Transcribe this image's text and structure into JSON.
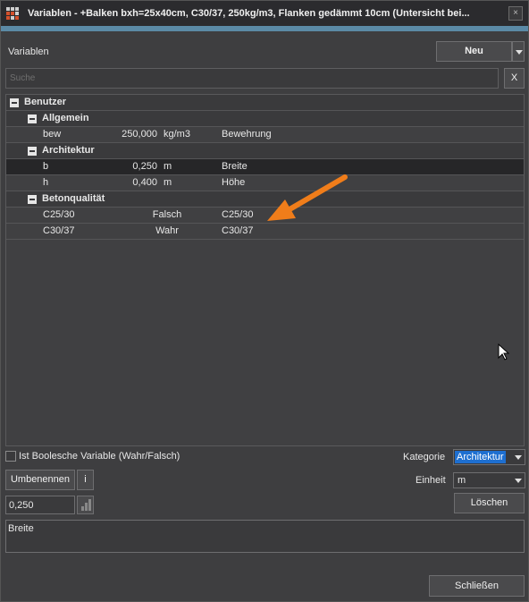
{
  "window": {
    "title": "Variablen - +Balken bxh=25x40cm, C30/37, 250kg/m3,  Flanken gedämmt 10cm (Untersicht bei...",
    "close_label": "×"
  },
  "header": {
    "label": "Variablen",
    "neu_label": "Neu"
  },
  "search": {
    "placeholder": "Suche",
    "clear_label": "X"
  },
  "tree": {
    "root": "Benutzer",
    "groups": [
      {
        "name": "Allgemein",
        "rows": [
          {
            "name": "bew",
            "value": "250,000",
            "unit": "kg/m3",
            "desc": "Bewehrung"
          }
        ]
      },
      {
        "name": "Architektur",
        "rows": [
          {
            "name": "b",
            "value": "0,250",
            "unit": "m",
            "desc": "Breite",
            "selected": true
          },
          {
            "name": "h",
            "value": "0,400",
            "unit": "m",
            "desc": "Höhe"
          }
        ]
      },
      {
        "name": "Betonqualität",
        "rows": [
          {
            "name": "C25/30",
            "value": "Falsch",
            "desc": "C25/30"
          },
          {
            "name": "C30/37",
            "value": "Wahr",
            "desc": "C30/37"
          }
        ]
      }
    ]
  },
  "bool_checkbox_label": "Ist Boolesche Variable (Wahr/Falsch)",
  "kategorie": {
    "label": "Kategorie",
    "value": "Architektur"
  },
  "einheit": {
    "label": "Einheit",
    "value": "m"
  },
  "buttons": {
    "umbenennen": "Umbenennen",
    "info": "i",
    "loeschen": "Löschen",
    "schliessen": "Schließen"
  },
  "value_input": "0,250",
  "description": "Breite",
  "colors": {
    "accent": "#5b8aa6",
    "annotation_arrow": "#f07d1a",
    "selection": "#1e6fd0"
  }
}
